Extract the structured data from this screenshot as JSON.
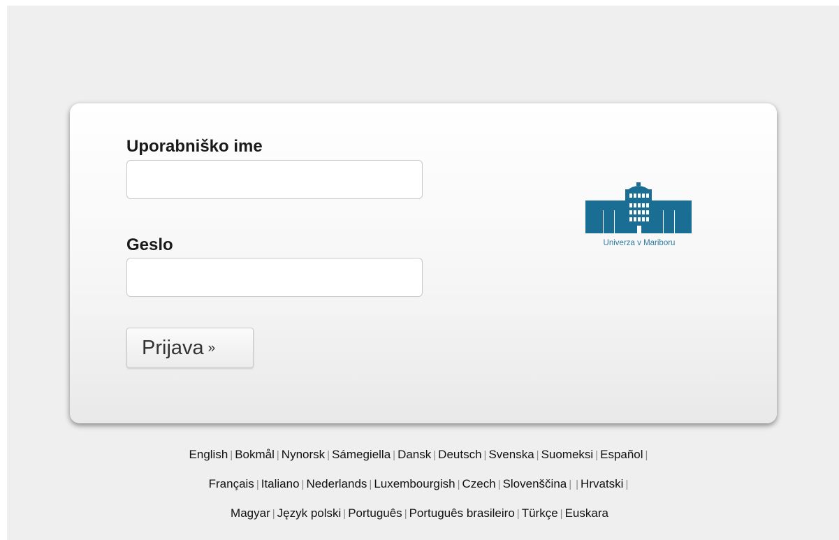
{
  "form": {
    "username_label": "Uporabniško ime",
    "username_value": "",
    "password_label": "Geslo",
    "password_value": "",
    "submit_label": "Prijava",
    "submit_arrows": "»"
  },
  "logo": {
    "text": "Univerza v Mariboru",
    "color": "#1a6d93"
  },
  "languages": {
    "separator": "|",
    "rows": [
      [
        "English",
        "Bokmål",
        "Nynorsk",
        "Sámegiella",
        "Dansk",
        "Deutsch",
        "Svenska",
        "Suomeksi",
        "Español",
        ""
      ],
      [
        "Français",
        "Italiano",
        "Nederlands",
        "Luxembourgish",
        "Czech",
        "Slovenščina",
        "",
        "Hrvatski",
        ""
      ],
      [
        "Magyar",
        "Język polski",
        "Português",
        "Português brasileiro",
        "Türkçe",
        "Euskara"
      ]
    ]
  }
}
